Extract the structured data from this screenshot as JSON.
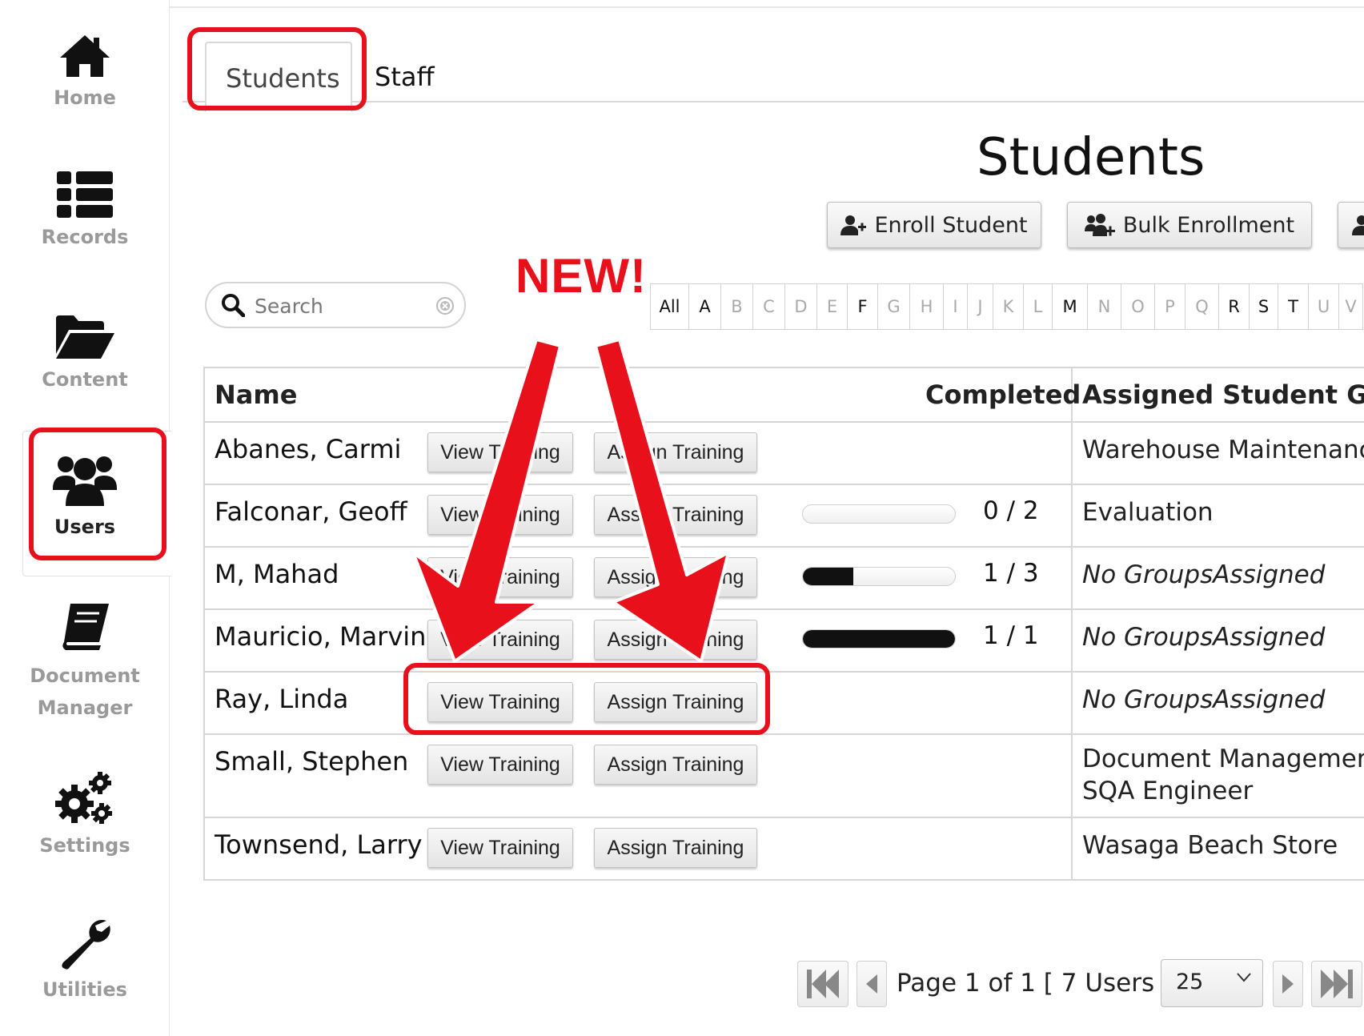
{
  "sidebar": {
    "items": [
      {
        "label": "Home",
        "icon": "home-icon"
      },
      {
        "label": "Records",
        "icon": "list-icon"
      },
      {
        "label": "Content",
        "icon": "folder-open-icon"
      },
      {
        "label": "Users",
        "icon": "users-icon"
      },
      {
        "label_line1": "Document",
        "label_line2": "Manager",
        "icon": "book-icon"
      },
      {
        "label": "Settings",
        "icon": "gears-icon"
      },
      {
        "label": "Utilities",
        "icon": "wrench-icon"
      }
    ]
  },
  "tabs": [
    {
      "label": "Students",
      "active": true
    },
    {
      "label": "Staff",
      "active": false
    }
  ],
  "page": {
    "title": "Students",
    "toolbar": {
      "enroll_label": "Enroll Student",
      "bulk_label": "Bulk Enrollment"
    }
  },
  "search": {
    "placeholder": "Search",
    "value": ""
  },
  "alphabet": {
    "letters": [
      "All",
      "A",
      "B",
      "C",
      "D",
      "E",
      "F",
      "G",
      "H",
      "I",
      "J",
      "K",
      "L",
      "M",
      "N",
      "O",
      "P",
      "Q",
      "R",
      "S",
      "T",
      "U",
      "V"
    ],
    "active": [
      "All",
      "A",
      "F",
      "M",
      "R",
      "S",
      "T"
    ]
  },
  "table": {
    "headers": {
      "name": "Name",
      "completed": "Completed",
      "groups": "Assigned Student Grou"
    },
    "view_training_label": "View Training",
    "assign_training_label": "Assign Training",
    "rows": [
      {
        "name": "Abanes, Carmi",
        "progress": null,
        "completed": "",
        "groups": [
          "Warehouse Maintenanc"
        ],
        "no_groups": false
      },
      {
        "name": "Falconar, Geoff",
        "progress": 0.0,
        "completed": "0 / 2",
        "groups": [
          "Evaluation"
        ],
        "no_groups": false
      },
      {
        "name": "M, Mahad",
        "progress": 0.333,
        "completed": "1 / 3",
        "groups": [
          "No GroupsAssigned"
        ],
        "no_groups": true
      },
      {
        "name": "Mauricio, Marvin",
        "progress": 1.0,
        "completed": "1 / 1",
        "groups": [
          "No GroupsAssigned"
        ],
        "no_groups": true
      },
      {
        "name": "Ray, Linda",
        "progress": null,
        "completed": "",
        "groups": [
          "No GroupsAssigned"
        ],
        "no_groups": true
      },
      {
        "name": "Small, Stephen",
        "progress": null,
        "completed": "",
        "groups": [
          "Document Management",
          "SQA Engineer"
        ],
        "no_groups": false
      },
      {
        "name": "Townsend, Larry",
        "progress": null,
        "completed": "",
        "groups": [
          "Wasaga Beach Store"
        ],
        "no_groups": false
      }
    ]
  },
  "pager": {
    "text": "Page 1 of 1 [ 7 Users ]",
    "per_page": "25"
  },
  "annotation": {
    "label": "NEW!",
    "color": "#e8101a"
  },
  "colors": {
    "accent_red": "#e8101a",
    "progress_fill": "#111111"
  }
}
